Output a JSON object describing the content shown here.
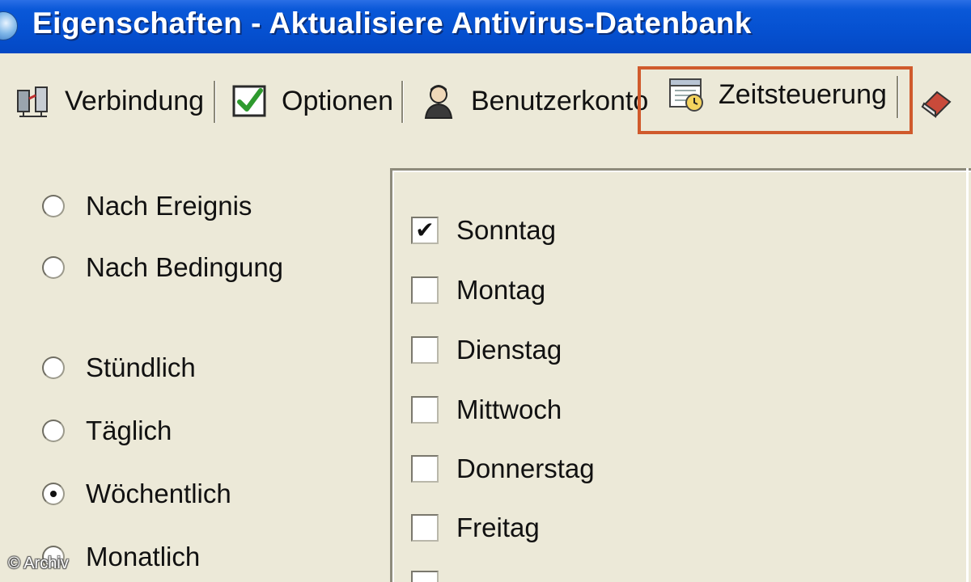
{
  "window": {
    "title": "Eigenschaften - Aktualisiere Antivirus-Datenbank"
  },
  "tabs": [
    {
      "label": "Verbindung",
      "icon": "network-icon"
    },
    {
      "label": "Optionen",
      "icon": "checkmark-icon"
    },
    {
      "label": "Benutzerkonto",
      "icon": "user-icon"
    },
    {
      "label": "Zeitsteuerung",
      "icon": "calendar-clock-icon",
      "active": true
    },
    {
      "label": "",
      "icon": "partial-tab-icon"
    }
  ],
  "schedule": {
    "options": [
      {
        "label": "Nach Ereignis",
        "checked": false
      },
      {
        "label": "Nach Bedingung",
        "checked": false
      },
      {
        "label": "Stündlich",
        "checked": false
      },
      {
        "label": "Täglich",
        "checked": false
      },
      {
        "label": "Wöchentlich",
        "checked": true
      },
      {
        "label": "Monatlich",
        "checked": false
      }
    ]
  },
  "days": [
    {
      "label": "Sonntag",
      "checked": true
    },
    {
      "label": "Montag",
      "checked": false
    },
    {
      "label": "Dienstag",
      "checked": false
    },
    {
      "label": "Mittwoch",
      "checked": false
    },
    {
      "label": "Donnerstag",
      "checked": false
    },
    {
      "label": "Freitag",
      "checked": false
    }
  ],
  "watermark": "© Archiv",
  "colors": {
    "titlebar": "#0550d0",
    "highlight": "#d05a2c",
    "background": "#ece9d8"
  }
}
